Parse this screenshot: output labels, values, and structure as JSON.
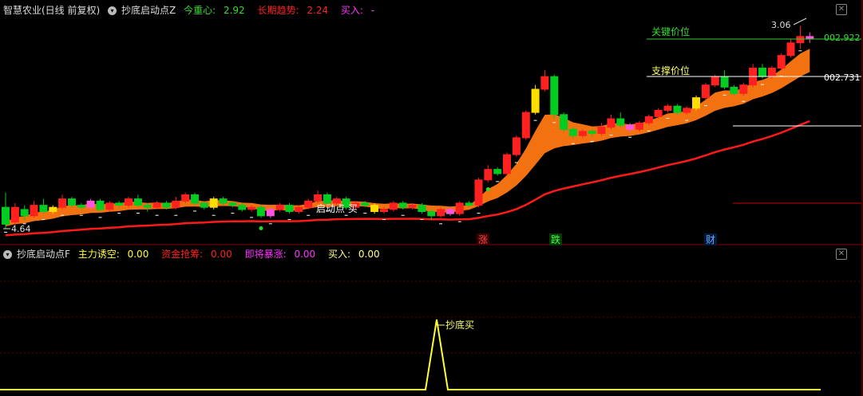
{
  "main_panel": {
    "stock_title": "智慧农业(日线 前复权)",
    "indicator_name": "抄底启动点Z",
    "legend": [
      {
        "label": "今重心:",
        "value": "2.92",
        "color": "#33dd33"
      },
      {
        "label": "长期趋势:",
        "value": "2.24",
        "color": "#ff2222"
      },
      {
        "label": "买入:",
        "value": "-",
        "color": "#ff33ff"
      }
    ],
    "key_price_label": "关键价位",
    "key_price_value": "002.922",
    "support_label": "支撑价位",
    "support_value": "002.731",
    "high_marker": "3.06",
    "low_marker": "4.64",
    "signal_text": "启动点 买",
    "markers": [
      {
        "text": "涨",
        "color": "#ff4444"
      },
      {
        "text": "跌",
        "color": "#44ff44"
      },
      {
        "text": "财",
        "color": "#66aaff"
      }
    ]
  },
  "sub_panel": {
    "indicator_name": "抄底启动点F",
    "legend": [
      {
        "label": "主力诱空:",
        "value": "0.00",
        "color": "#ffff33"
      },
      {
        "label": "资金抢筹:",
        "value": "0.00",
        "color": "#ff2222"
      },
      {
        "label": "即将暴涨:",
        "value": "0.00",
        "color": "#ff33ff"
      },
      {
        "label": "买入:",
        "value": "0.00",
        "color": "#ffff88"
      }
    ],
    "buy_label": "抄底买"
  },
  "chart_data": {
    "type": "candlestick",
    "candles": [
      [
        2.4,
        2.32,
        2.47,
        2.3
      ],
      [
        2.33,
        2.4,
        2.42,
        2.31
      ],
      [
        2.39,
        2.36,
        2.41,
        2.34
      ],
      [
        2.36,
        2.41,
        2.43,
        2.35
      ],
      [
        2.41,
        2.38,
        2.44,
        2.37
      ],
      [
        2.38,
        2.4,
        2.41,
        2.37
      ],
      [
        2.4,
        2.44,
        2.46,
        2.39
      ],
      [
        2.44,
        2.41,
        2.45,
        2.4
      ],
      [
        2.41,
        2.4,
        2.42,
        2.39
      ],
      [
        2.4,
        2.43,
        2.44,
        2.39
      ],
      [
        2.43,
        2.39,
        2.44,
        2.38
      ],
      [
        2.39,
        2.42,
        2.43,
        2.38
      ],
      [
        2.42,
        2.41,
        2.43,
        2.4
      ],
      [
        2.41,
        2.44,
        2.45,
        2.4
      ],
      [
        2.44,
        2.41,
        2.46,
        2.4
      ],
      [
        2.41,
        2.4,
        2.42,
        2.38
      ],
      [
        2.4,
        2.42,
        2.43,
        2.39
      ],
      [
        2.42,
        2.4,
        2.43,
        2.39
      ],
      [
        2.4,
        2.43,
        2.45,
        2.39
      ],
      [
        2.43,
        2.46,
        2.47,
        2.42
      ],
      [
        2.46,
        2.42,
        2.47,
        2.41
      ],
      [
        2.42,
        2.4,
        2.43,
        2.39
      ],
      [
        2.4,
        2.44,
        2.45,
        2.39
      ],
      [
        2.44,
        2.42,
        2.45,
        2.41
      ],
      [
        2.42,
        2.41,
        2.43,
        2.4
      ],
      [
        2.41,
        2.39,
        2.42,
        2.38
      ],
      [
        2.39,
        2.4,
        2.41,
        2.38
      ],
      [
        2.4,
        2.36,
        2.41,
        2.35
      ],
      [
        2.36,
        2.39,
        2.4,
        2.35
      ],
      [
        2.39,
        2.41,
        2.42,
        2.38
      ],
      [
        2.41,
        2.38,
        2.42,
        2.37
      ],
      [
        2.38,
        2.4,
        2.41,
        2.37
      ],
      [
        2.4,
        2.43,
        2.44,
        2.39
      ],
      [
        2.43,
        2.46,
        2.48,
        2.42
      ],
      [
        2.46,
        2.42,
        2.47,
        2.41
      ],
      [
        2.42,
        2.44,
        2.45,
        2.41
      ],
      [
        2.44,
        2.4,
        2.45,
        2.39
      ],
      [
        2.4,
        2.42,
        2.43,
        2.39
      ],
      [
        2.42,
        2.41,
        2.43,
        2.4
      ],
      [
        2.41,
        2.38,
        2.42,
        2.37
      ],
      [
        2.38,
        2.39,
        2.4,
        2.37
      ],
      [
        2.39,
        2.42,
        2.43,
        2.38
      ],
      [
        2.42,
        2.4,
        2.43,
        2.39
      ],
      [
        2.4,
        2.41,
        2.42,
        2.39
      ],
      [
        2.41,
        2.38,
        2.42,
        2.37
      ],
      [
        2.38,
        2.36,
        2.39,
        2.34
      ],
      [
        2.36,
        2.39,
        2.4,
        2.35
      ],
      [
        2.39,
        2.37,
        2.4,
        2.36
      ],
      [
        2.37,
        2.42,
        2.43,
        2.36
      ],
      [
        2.42,
        2.41,
        2.43,
        2.4
      ],
      [
        2.41,
        2.53,
        2.54,
        2.4
      ],
      [
        2.53,
        2.58,
        2.6,
        2.52
      ],
      [
        2.58,
        2.56,
        2.59,
        2.55
      ],
      [
        2.56,
        2.65,
        2.66,
        2.55
      ],
      [
        2.65,
        2.73,
        2.74,
        2.64
      ],
      [
        2.73,
        2.85,
        2.86,
        2.72
      ],
      [
        2.85,
        2.96,
        2.98,
        2.84
      ],
      [
        2.96,
        3.02,
        3.05,
        2.95
      ],
      [
        3.02,
        2.84,
        3.03,
        2.82
      ],
      [
        2.84,
        2.77,
        2.85,
        2.76
      ],
      [
        2.77,
        2.74,
        2.78,
        2.73
      ],
      [
        2.74,
        2.76,
        2.77,
        2.73
      ],
      [
        2.76,
        2.75,
        2.77,
        2.74
      ],
      [
        2.75,
        2.78,
        2.8,
        2.74
      ],
      [
        2.78,
        2.82,
        2.84,
        2.77
      ],
      [
        2.82,
        2.79,
        2.85,
        2.78
      ],
      [
        2.79,
        2.77,
        2.8,
        2.76
      ],
      [
        2.77,
        2.8,
        2.81,
        2.76
      ],
      [
        2.8,
        2.83,
        2.84,
        2.79
      ],
      [
        2.83,
        2.86,
        2.87,
        2.82
      ],
      [
        2.86,
        2.88,
        2.89,
        2.85
      ],
      [
        2.88,
        2.85,
        2.89,
        2.84
      ],
      [
        2.85,
        2.87,
        2.88,
        2.84
      ],
      [
        2.87,
        2.92,
        2.93,
        2.86
      ],
      [
        2.92,
        2.98,
        2.99,
        2.91
      ],
      [
        2.98,
        3.02,
        3.03,
        2.97
      ],
      [
        3.02,
        2.97,
        3.05,
        2.96
      ],
      [
        2.97,
        2.94,
        2.98,
        2.93
      ],
      [
        2.94,
        2.98,
        2.99,
        2.93
      ],
      [
        2.98,
        3.06,
        3.08,
        2.97
      ],
      [
        3.06,
        3.02,
        3.08,
        3.01
      ],
      [
        3.02,
        3.06,
        3.07,
        3.01
      ],
      [
        3.06,
        3.12,
        3.13,
        3.05
      ],
      [
        3.12,
        3.18,
        3.2,
        3.11
      ],
      [
        3.18,
        3.21,
        3.26,
        3.15
      ],
      [
        3.21,
        3.2,
        3.23,
        3.18
      ]
    ],
    "ylim": [
      2.28,
      3.3
    ]
  }
}
